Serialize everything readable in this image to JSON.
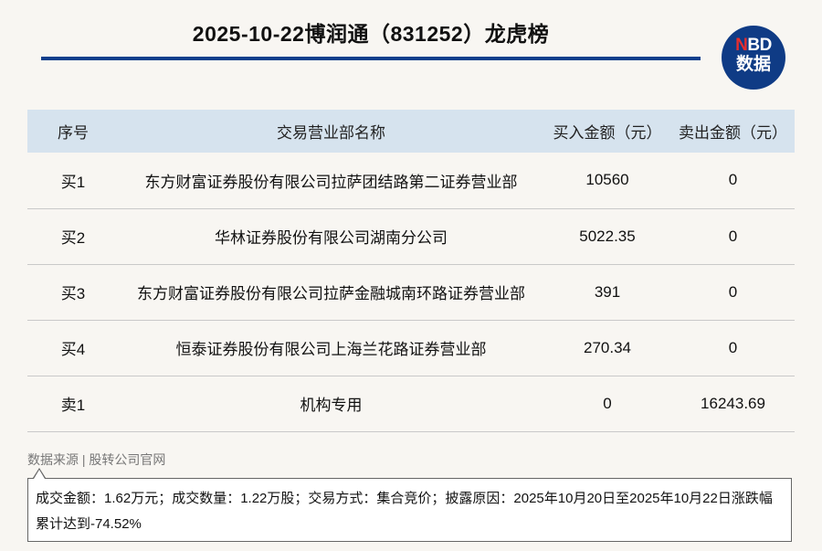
{
  "header": {
    "title": "2025-10-22博润通（831252）龙虎榜",
    "logo_top": "NBD",
    "logo_top_accent": "N",
    "logo_top_rest": "BD",
    "logo_bottom": "数据",
    "accent_color": "#0e3f8c"
  },
  "table": {
    "columns": [
      "序号",
      "交易营业部名称",
      "买入金额（元）",
      "卖出金额（元）"
    ],
    "rows": [
      {
        "seq": "买1",
        "name": "东方财富证券股份有限公司拉萨团结路第二证券营业部",
        "buy": "10560",
        "sell": "0"
      },
      {
        "seq": "买2",
        "name": "华林证券股份有限公司湖南分公司",
        "buy": "5022.35",
        "sell": "0"
      },
      {
        "seq": "买3",
        "name": "东方财富证券股份有限公司拉萨金融城南环路证券营业部",
        "buy": "391",
        "sell": "0"
      },
      {
        "seq": "买4",
        "name": "恒泰证券股份有限公司上海兰花路证券营业部",
        "buy": "270.34",
        "sell": "0"
      },
      {
        "seq": "卖1",
        "name": "机构专用",
        "buy": "0",
        "sell": "16243.69"
      }
    ]
  },
  "footer": {
    "source": "数据来源 | 股转公司官网",
    "note": "成交金额：1.62万元；成交数量：1.22万股；交易方式：集合竞价；披露原因：2025年10月20日至2025年10月22日涨跌幅累计达到-74.52%"
  }
}
